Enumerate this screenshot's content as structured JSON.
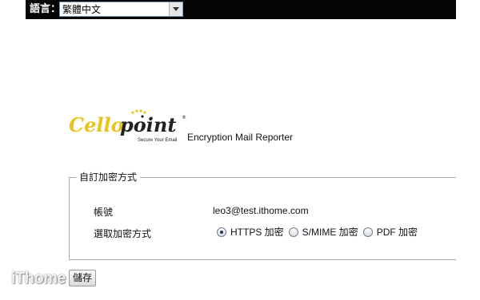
{
  "language_bar": {
    "label": "語言：",
    "selected": "繁體中文"
  },
  "header": {
    "logo_text": "Cellopoint",
    "logo_tagline": "Secure Your Email",
    "app_title": "Encryption Mail Reporter"
  },
  "form": {
    "legend": "自訂加密方式",
    "account_label": "帳號",
    "account_value": "leo3@test.ithome.com",
    "method_label": "選取加密方式",
    "options": [
      {
        "label": "HTTPS 加密",
        "checked": true
      },
      {
        "label": "S/MIME 加密",
        "checked": false
      },
      {
        "label": "PDF 加密",
        "checked": false
      }
    ],
    "save_label": "儲存"
  },
  "watermark": "iThome",
  "colors": {
    "topbar": "#050505",
    "logo_yellow": "#e8c41c",
    "logo_dark": "#222222"
  }
}
